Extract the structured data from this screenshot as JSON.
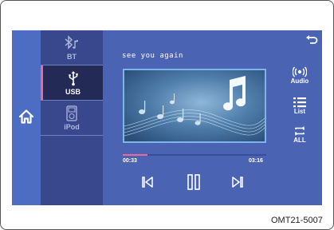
{
  "sources": [
    {
      "label": "BT",
      "icon": "bluetooth-music-icon",
      "active": false
    },
    {
      "label": "USB",
      "icon": "usb-icon",
      "active": true
    },
    {
      "label": "iPod",
      "icon": "ipod-icon",
      "active": false
    }
  ],
  "track": {
    "title": "see you again",
    "elapsed": "00:33",
    "duration": "03:16",
    "progress": 0.17
  },
  "right_controls": [
    {
      "label": "Audio",
      "icon": "audio-icon"
    },
    {
      "label": "List",
      "icon": "list-icon"
    },
    {
      "label": "ALL",
      "icon": "repeat-all-icon"
    }
  ],
  "figure_code": "OMT21-5007",
  "colors": {
    "screen": "#4a63b3",
    "source_panel": "#39488d",
    "active_source": "#222a55",
    "accent": "#e86a9c",
    "art_border": "#7db4ec"
  }
}
